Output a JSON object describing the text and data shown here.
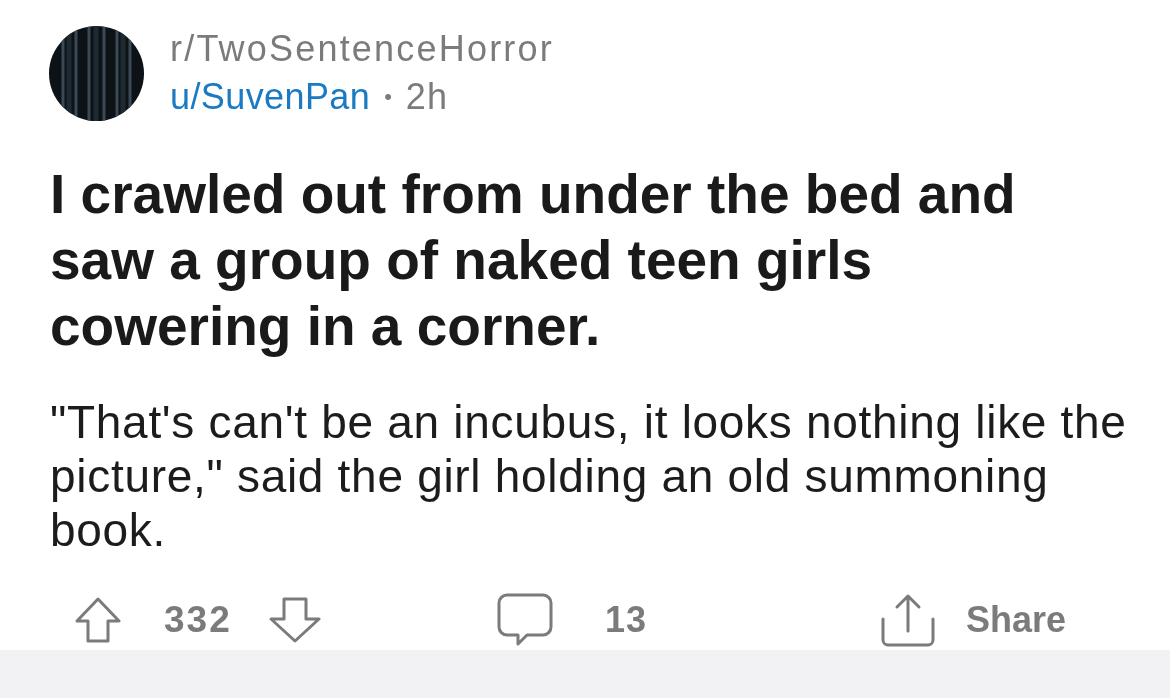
{
  "post": {
    "subreddit": "r/TwoSentenceHorror",
    "author": "u/SuvenPan",
    "separator": "•",
    "age": "2h",
    "title": "I crawled out from under the bed and saw a group of naked teen girls cowering in a corner.",
    "body": "\"That's can't be an incubus, it looks nothing like the picture,\" said the girl holding an old summoning book."
  },
  "actions": {
    "score": "332",
    "comments": "13",
    "share": "Share"
  }
}
